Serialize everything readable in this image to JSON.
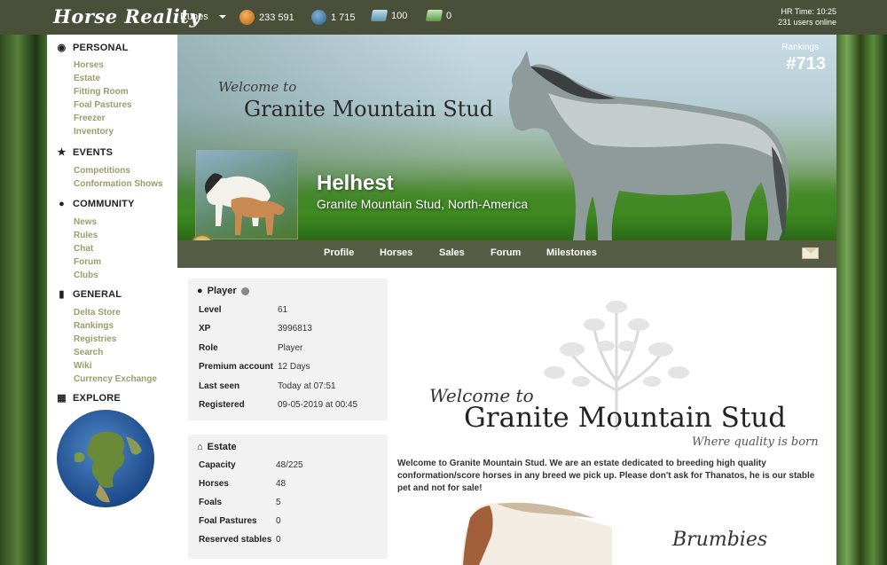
{
  "topbar": {
    "logo": "Horse Reality",
    "runes_label": "Runes",
    "currencies": [
      {
        "icon": "rune-coin-icon",
        "value": "233 591"
      },
      {
        "icon": "delta-coin-icon",
        "value": "1 715"
      },
      {
        "icon": "blue-ticket-icon",
        "value": "100"
      },
      {
        "icon": "green-ticket-icon",
        "value": "0"
      }
    ],
    "time": "HR Time: 10:25",
    "users_online": "231 users online"
  },
  "sidebar": {
    "personal": {
      "title": "PERSONAL",
      "items": [
        "Horses",
        "Estate",
        "Fitting Room",
        "Foal Pastures",
        "Freezer",
        "Inventory"
      ]
    },
    "events": {
      "title": "EVENTS",
      "items": [
        "Competitions",
        "Conformation Shows"
      ]
    },
    "community": {
      "title": "COMMUNITY",
      "items": [
        "News",
        "Rules",
        "Chat",
        "Forum",
        "Clubs"
      ]
    },
    "general": {
      "title": "GENERAL",
      "items": [
        "Delta Store",
        "Rankings",
        "Registries",
        "Search",
        "Wiki",
        "Currency Exchange"
      ]
    },
    "explore": {
      "title": "EXPLORE"
    }
  },
  "banner": {
    "welcome": "Welcome to",
    "stud": "Granite Mountain Stud",
    "player_name": "Helhest",
    "location": "Granite Mountain Stud, North-America",
    "rankings_label": "Rankings",
    "rank": "#713"
  },
  "nav": {
    "items": [
      "Profile",
      "Horses",
      "Sales",
      "Forum",
      "Milestones"
    ]
  },
  "player_card": {
    "title": "Player",
    "rows": [
      {
        "label": "Level",
        "value": "61"
      },
      {
        "label": "XP",
        "value": "3996813"
      },
      {
        "label": "Role",
        "value": "Player"
      },
      {
        "label": "Premium account",
        "value": "12 Days"
      },
      {
        "label": "Last seen",
        "value": "Today at 07:51"
      },
      {
        "label": "Registered",
        "value": "09-05-2019 at 00:45"
      }
    ]
  },
  "estate_card": {
    "title": "Estate",
    "rows": [
      {
        "label": "Capacity",
        "value": "48/225"
      },
      {
        "label": "Horses",
        "value": "48"
      },
      {
        "label": "Foals",
        "value": "5"
      },
      {
        "label": "Foal Pastures",
        "value": "0"
      },
      {
        "label": "Reserved stables",
        "value": "0"
      }
    ]
  },
  "profile": {
    "welcome": "Welcome to",
    "stud": "Granite Mountain Stud",
    "motto": "Where quality is born",
    "description": "Welcome to Granite Mountain Stud. We are an estate dedicated to breeding high quality conformation/score horses in any breed we pick up. Please don't ask for Thanatos, he is our stable pet and not for sale!",
    "section": "Brumbies"
  },
  "colors": {
    "topbar": "#4a4f3a",
    "nav": "#575c44",
    "sidebar_link": "#9b9d6a"
  }
}
